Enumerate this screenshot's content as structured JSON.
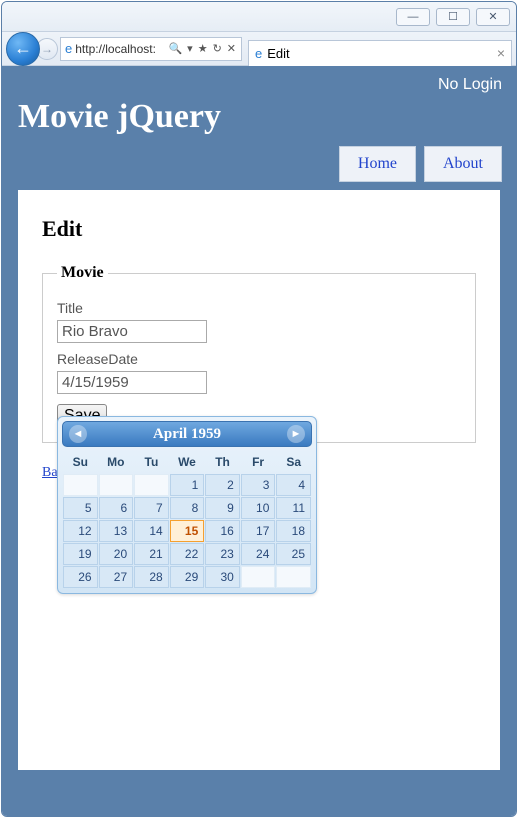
{
  "window": {
    "min": "—",
    "max": "☐",
    "close": "✕"
  },
  "addressbar": {
    "url": "http://localhost:",
    "search_glyph": "🔍",
    "dropdown_glyph": "▾",
    "favorites_glyph": "★",
    "refresh_glyph": "↻",
    "stop_glyph": "✕"
  },
  "tab": {
    "title": "Edit",
    "close": "×"
  },
  "header": {
    "login": "No Login",
    "brand": "Movie jQuery"
  },
  "nav": {
    "home": "Home",
    "about": "About"
  },
  "page": {
    "heading": "Edit",
    "legend": "Movie",
    "title_label": "Title",
    "title_value": "Rio Bravo",
    "date_label": "ReleaseDate",
    "date_value": "4/15/1959",
    "save": "Save",
    "back": "Back to List"
  },
  "datepicker": {
    "header": "April 1959",
    "prev": "◄",
    "next": "►",
    "dow": [
      "Su",
      "Mo",
      "Tu",
      "We",
      "Th",
      "Fr",
      "Sa"
    ],
    "grid": [
      [
        "",
        "",
        "",
        1,
        2,
        3,
        4
      ],
      [
        5,
        6,
        7,
        8,
        9,
        10,
        11
      ],
      [
        12,
        13,
        14,
        15,
        16,
        17,
        18
      ],
      [
        19,
        20,
        21,
        22,
        23,
        24,
        25
      ],
      [
        26,
        27,
        28,
        29,
        30,
        "",
        ""
      ]
    ],
    "selected": 15
  }
}
